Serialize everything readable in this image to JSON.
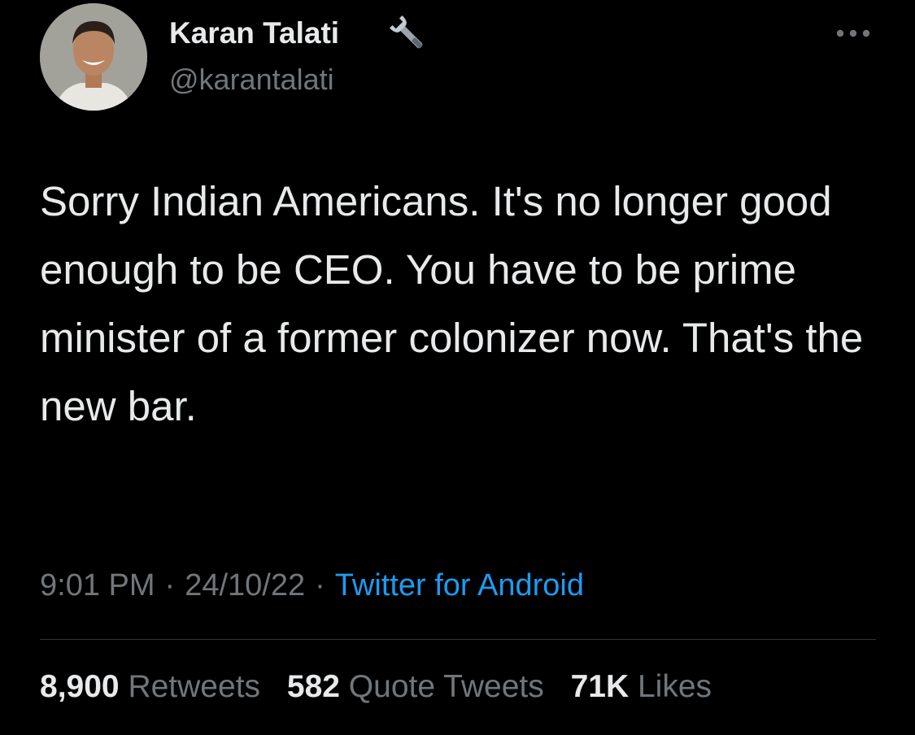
{
  "author": {
    "display_name": "Karan Talati",
    "handle": "@karantalati",
    "avatar": "avatar-photo",
    "badge_icon": "wrench-icon"
  },
  "menu_icon": "more-dots-icon",
  "tweet": {
    "text": "Sorry Indian Americans. It's no longer good enough to be CEO. You have to be prime minister of a former colonizer now. That's the new bar."
  },
  "meta": {
    "time": "9:01 PM",
    "separator": "·",
    "date": "24/10/22",
    "source": "Twitter for Android"
  },
  "stats": {
    "retweets_count": "8,900",
    "retweets_label": "Retweets",
    "quotes_count": "582",
    "quotes_label": "Quote Tweets",
    "likes_count": "71K",
    "likes_label": "Likes"
  },
  "colors": {
    "background": "#000000",
    "primary_text": "#e7e9ea",
    "secondary_text": "#71767b",
    "link": "#1d9bf0",
    "divider": "#2f3336"
  }
}
